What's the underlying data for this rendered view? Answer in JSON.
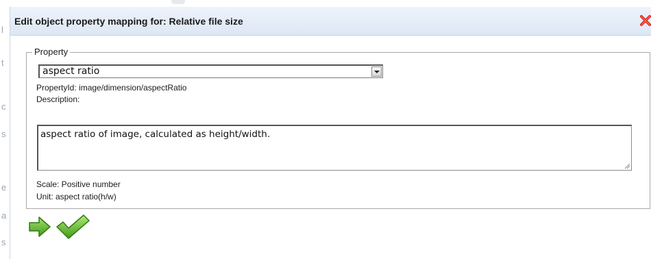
{
  "background": {
    "letters": [
      "l",
      "t",
      "c",
      "s",
      "e",
      "a",
      "s"
    ]
  },
  "dialog": {
    "title": "Edit object property mapping for: Relative file size",
    "close_icon": "close-x-icon"
  },
  "property": {
    "legend": "Property",
    "select_value": "aspect ratio",
    "property_id_text": "PropertyId: image/dimension/aspectRatio",
    "description_label": "Description:",
    "description_value": "aspect ratio of image, calculated as height/width.",
    "scale_text": "Scale: Positive number",
    "unit_text": "Unit: aspect ratio(h/w)"
  },
  "actions": {
    "next_icon": "green-arrow-right-icon",
    "confirm_icon": "green-checkmark-icon"
  },
  "colors": {
    "title_bar": "#dde7f4",
    "close_red": "#d9261c",
    "action_green": "#5cae2b"
  }
}
